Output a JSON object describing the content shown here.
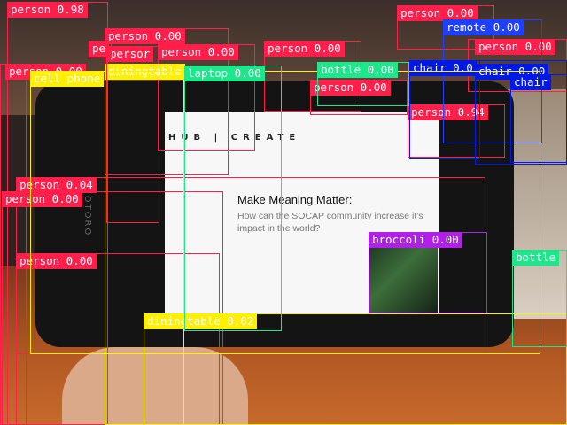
{
  "palette": {
    "person": "#ff1f4b",
    "chair": "#0019e6",
    "remote": "#1f3fff",
    "diningtable": "#ffef00",
    "laptop": "#1fe68a",
    "bottle": "#1fe68a",
    "cellphone": "#ffef00",
    "broccoli": "#b020e6"
  },
  "slide": {
    "header": "HUB | CREATE",
    "title": "Make Meaning Matter:",
    "body": "How can the SOCAP community increase it's impact in the world?"
  },
  "phone_brand": "MOTORO",
  "detections": [
    {
      "label": "person 0.98",
      "cls": "person"
    },
    {
      "label": "person 0.00",
      "cls": "person"
    },
    {
      "label": "person 0.00",
      "cls": "person"
    },
    {
      "label": "person 0.00",
      "cls": "person"
    },
    {
      "label": "person 0.00",
      "cls": "person"
    },
    {
      "label": "person 0.00",
      "cls": "person"
    },
    {
      "label": "person 0.00",
      "cls": "person"
    },
    {
      "label": "person 0.00",
      "cls": "person"
    },
    {
      "label": "person 0.94",
      "cls": "person"
    },
    {
      "label": "person 0.04",
      "cls": "person"
    },
    {
      "label": "person 0.00",
      "cls": "person"
    },
    {
      "label": "person 0.00",
      "cls": "person"
    },
    {
      "label": "remote 0.00",
      "cls": "remote"
    },
    {
      "label": "chair 0.0",
      "cls": "chair"
    },
    {
      "label": "chair 0.00",
      "cls": "chair"
    },
    {
      "label": "chair",
      "cls": "chair"
    },
    {
      "label": "diningtable",
      "cls": "diningtable"
    },
    {
      "label": "diningtable 0.02",
      "cls": "diningtable"
    },
    {
      "label": "cell phone",
      "cls": "cellphone"
    },
    {
      "label": "laptop 0.00",
      "cls": "laptop"
    },
    {
      "label": "bottle 0.00",
      "cls": "bottle"
    },
    {
      "label": "bottle",
      "cls": "bottle"
    },
    {
      "label": "broccoli 0.00",
      "cls": "broccoli"
    },
    {
      "label": "persor",
      "cls": "person"
    },
    {
      "label": "pe",
      "cls": "person"
    }
  ]
}
